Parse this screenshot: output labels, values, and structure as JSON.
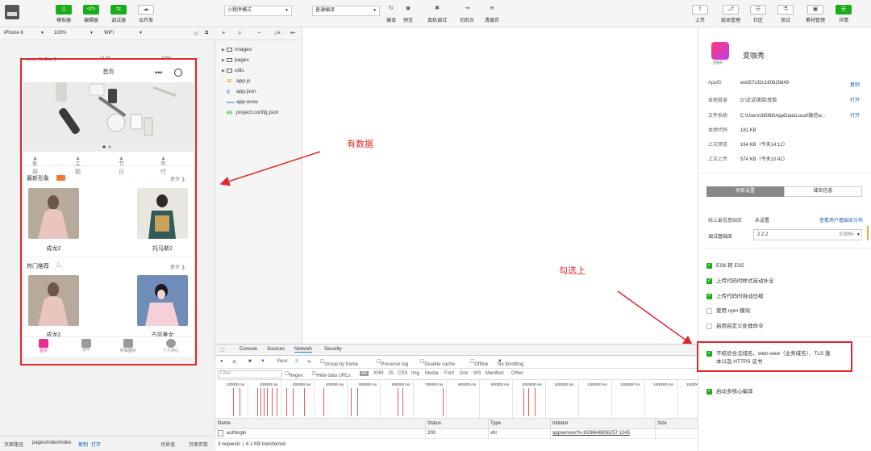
{
  "toolbar": {
    "buttons": [
      "模拟器",
      "编辑器",
      "调试器",
      "云开发"
    ],
    "mode_select": "小程序模式",
    "compile_select": "普通编译",
    "actions": [
      "编译",
      "预览",
      "真机调试",
      "切后台",
      "清缓存"
    ],
    "right_buttons": [
      "上传",
      "版本管理",
      "社区",
      "测试",
      "素材管理",
      "详情"
    ]
  },
  "device": {
    "model": "iPhone 6",
    "zoom": "100%",
    "network": "WiFi"
  },
  "phone": {
    "status_left": "●●●●● WeChat令",
    "status_time": "14:37",
    "status_right": "100%",
    "title": "首页",
    "tabs": [
      "影视",
      "主题",
      "节日",
      "年代"
    ],
    "section1": {
      "title": "最新形象",
      "more": "更多",
      "items": [
        "成龙2",
        "托马斯2"
      ]
    },
    "section2": {
      "title": "热门推荐",
      "more": "更多",
      "items": [
        "成龙2",
        "古风美女"
      ]
    },
    "bottom_nav": [
      "首页",
      "DIY",
      "所有图片",
      "个人中心"
    ]
  },
  "files": {
    "items": [
      {
        "name": "images",
        "type": "folder"
      },
      {
        "name": "pages",
        "type": "folder"
      },
      {
        "name": "utils",
        "type": "folder"
      },
      {
        "name": "app.js",
        "type": "js"
      },
      {
        "name": "app.json",
        "type": "json"
      },
      {
        "name": "app.wxss",
        "type": "wxss"
      },
      {
        "name": "project.config.json",
        "type": "config"
      }
    ]
  },
  "annotations": {
    "data_label": "有数据",
    "check_label": "勾选上"
  },
  "devtools": {
    "tabs": [
      "Console",
      "Sources",
      "Network",
      "Security"
    ],
    "view_label": "View:",
    "group_by_frame": "Group by frame",
    "preserve_log": "Preserve log",
    "disable_cache": "Disable cache",
    "offline": "Offline",
    "throttle": "No throttling",
    "filter_placeholder": "Filter",
    "regex": "Regex",
    "hide_data_urls": "Hide data URLs",
    "type_filters": [
      "All",
      "XHR",
      "JS",
      "CSS",
      "Img",
      "Media",
      "Font",
      "Doc",
      "WS",
      "Manifest",
      "Other"
    ],
    "timeline_ticks": [
      "100000 ms",
      "200000 ms",
      "300000 ms",
      "400000 ms",
      "500000 ms",
      "600000 ms",
      "700000 ms",
      "800000 ms",
      "900000 ms",
      "1000000 ms",
      "1100000 ms",
      "1200000 ms",
      "1300000 ms",
      "1400000 ms",
      "1500000 ms"
    ],
    "columns": [
      "Name",
      "Status",
      "Type",
      "Initiator",
      "Size"
    ],
    "rows": [
      {
        "name": "authlogin",
        "status": "200",
        "type": "xhr",
        "initiator": "appservice?t=1536646856257:1245"
      }
    ],
    "summary": "3 requests │ 6.1 KB transferred"
  },
  "panel": {
    "app_name": "变咖秀",
    "logo_caption": "变咖秀",
    "info": [
      {
        "k": "AppID",
        "v": "wxb57c32c160628d49",
        "link": "复制"
      },
      {
        "k": "本地目录",
        "v": "D:\\正式项目\\变脸",
        "link": "打开"
      },
      {
        "k": "文件系统",
        "v": "C:\\Users\\38089\\AppData\\Local\\微信w...",
        "link": "打开"
      },
      {
        "k": "本地代码",
        "v": "181 KB",
        "link": ""
      },
      {
        "k": "上次预览",
        "v": "164 KB（今天14:12）",
        "link": ""
      },
      {
        "k": "上次上传",
        "v": "574 KB（今天10:42）",
        "link": ""
      }
    ],
    "tabs": [
      "项目设置",
      "域名信息"
    ],
    "base_lib_label": "线上最低基础库",
    "base_lib_value": "未设置",
    "base_lib_link": "查看用户基础库分布",
    "debug_lib_label": "调试基础库",
    "debug_lib_value": "2.2.2",
    "debug_lib_pct": "0.00%",
    "checks": [
      {
        "label": "ES6 转 ES5",
        "on": true
      },
      {
        "label": "上传代码时样式自动补全",
        "on": true
      },
      {
        "label": "上传代码时自动压缩",
        "on": true
      },
      {
        "label": "使用 npm 模块",
        "on": false
      },
      {
        "label": "启用自定义处理命令",
        "on": false
      }
    ],
    "highlight_check_line1": "不校验合法域名、web-view（业务域名）、TLS 版",
    "highlight_check_line2": "本以及 HTTPS 证书",
    "multi_core": "启动多核心编译"
  },
  "footer": {
    "path_label": "页面路径",
    "path": "pages/index/index",
    "copy": "复制",
    "open": "打开",
    "scene": "场景值",
    "params": "页面参数"
  }
}
